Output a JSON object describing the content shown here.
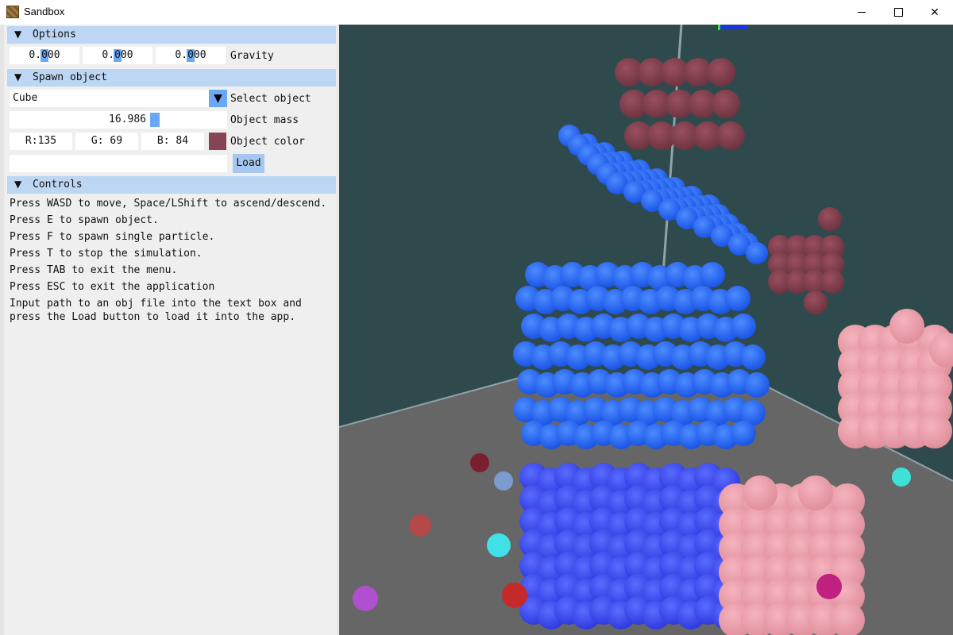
{
  "window": {
    "title": "Sandbox"
  },
  "options": {
    "header": "Options",
    "gravity_x": "0.000",
    "gravity_y": "0.000",
    "gravity_z": "0.000",
    "gravity_label": "Gravity"
  },
  "spawn": {
    "header": "Spawn object",
    "object_selected": "Cube",
    "select_label": "Select object",
    "mass_value": "16.986",
    "mass_label": "Object mass",
    "color_r": "R:135",
    "color_g": "G: 69",
    "color_b": "B: 84",
    "color_label": "Object color",
    "color_hex": "#874554",
    "path_value": "",
    "load_label": "Load"
  },
  "controls": {
    "header": "Controls",
    "lines": [
      "Press WASD to move, Space/LShift to ascend/descend.",
      "Press E to spawn object.",
      "Press F to spawn single particle.",
      "Press T to stop the simulation.",
      "Press TAB to exit the menu.",
      "Press ESC to exit the application",
      "Input path to an obj file into the text box and",
      "press the Load button to load it into the app."
    ]
  },
  "colors": {
    "header_bg": "#bcd6f3",
    "accent": "#6aa8f5",
    "scene_bg": "#2f4a4c",
    "floor": "#666666"
  }
}
